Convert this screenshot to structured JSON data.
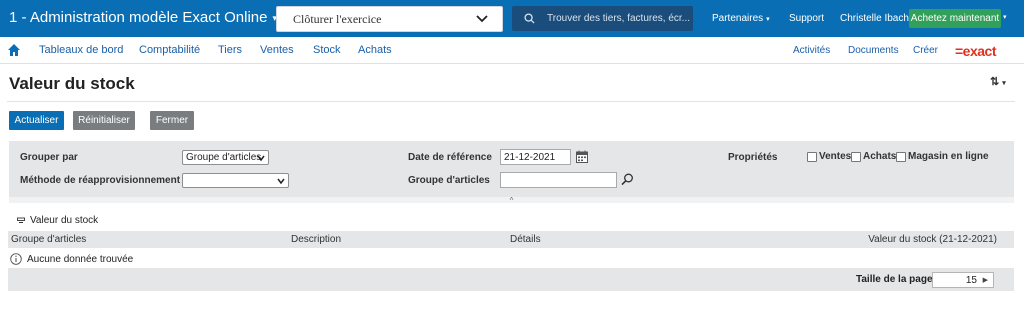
{
  "topbar": {
    "app_title": "1 - Administration modèle Exact Online",
    "wizard_value": "Clôturer l'exercice",
    "search_placeholder": "Trouver des tiers, factures, écr...",
    "partners": "Partenaires",
    "support": "Support",
    "user": "Christelle Ibach",
    "buy_button": "Achetez maintenant"
  },
  "nav": {
    "items": [
      "Tableaux de bord",
      "Comptabilité",
      "Tiers",
      "Ventes",
      "Stock",
      "Achats"
    ],
    "right": [
      "Activités",
      "Documents",
      "Créer"
    ],
    "logo": "=exact"
  },
  "page": {
    "title": "Valeur du stock",
    "sort_label": "⇅"
  },
  "buttons": {
    "refresh": "Actualiser",
    "reset": "Réinitialiser",
    "close": "Fermer"
  },
  "filters": {
    "group_by_label": "Grouper par",
    "group_by_value": "Groupe d'articles",
    "replenishment_label": "Méthode de réapprovisionnement",
    "replenishment_value": "",
    "reference_date_label": "Date de référence",
    "reference_date_value": "21-12-2021",
    "item_group_label": "Groupe d'articles",
    "item_group_value": "",
    "properties_label": "Propriétés",
    "properties": [
      "Ventes",
      "Achats",
      "Magasin en ligne"
    ]
  },
  "results": {
    "section_title": "Valeur du stock",
    "columns": [
      "Groupe d'articles",
      "Description",
      "Détails",
      "Valeur du stock (21-12-2021)"
    ],
    "empty_message": "Aucune donnée trouvée",
    "page_size_label": "Taille de la page",
    "page_size_value": "15"
  },
  "colors": {
    "brand_blue": "#0a6eb4",
    "buy_green": "#31a05a",
    "logo_red": "#e0301e"
  }
}
